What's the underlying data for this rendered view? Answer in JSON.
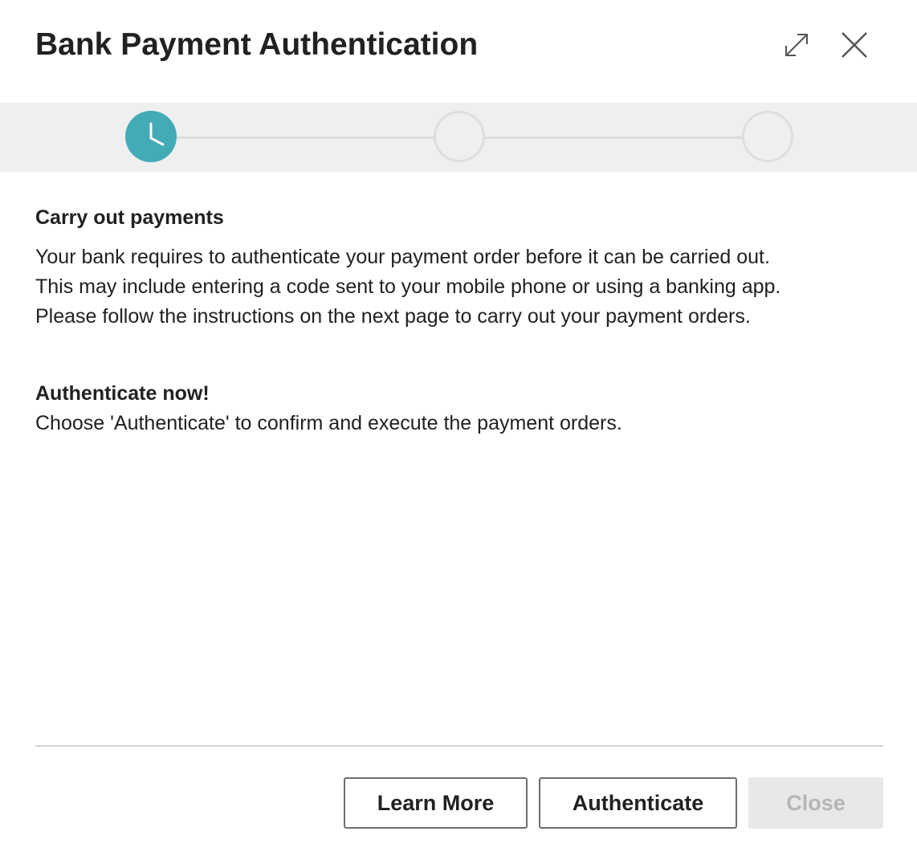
{
  "dialog": {
    "title": "Bank Payment Authentication",
    "expand_icon": "expand-icon",
    "close_icon": "close-icon"
  },
  "wizard": {
    "total_steps": 3,
    "current_step": 1,
    "active_step_icon": "clock-icon",
    "accent_color": "#43aab8"
  },
  "content": {
    "section1": {
      "heading": "Carry out payments",
      "lines": [
        "Your bank requires to authenticate your payment order before it can be carried out.",
        "This may include entering a code sent to your mobile phone or using a banking app.",
        "Please follow the instructions on the next page to carry out your payment orders."
      ]
    },
    "section2": {
      "heading": "Authenticate now!",
      "text": "Choose 'Authenticate' to confirm and execute the payment orders."
    }
  },
  "footer": {
    "learn_more_label": "Learn More",
    "authenticate_label": "Authenticate",
    "close_label": "Close",
    "close_disabled": true
  }
}
